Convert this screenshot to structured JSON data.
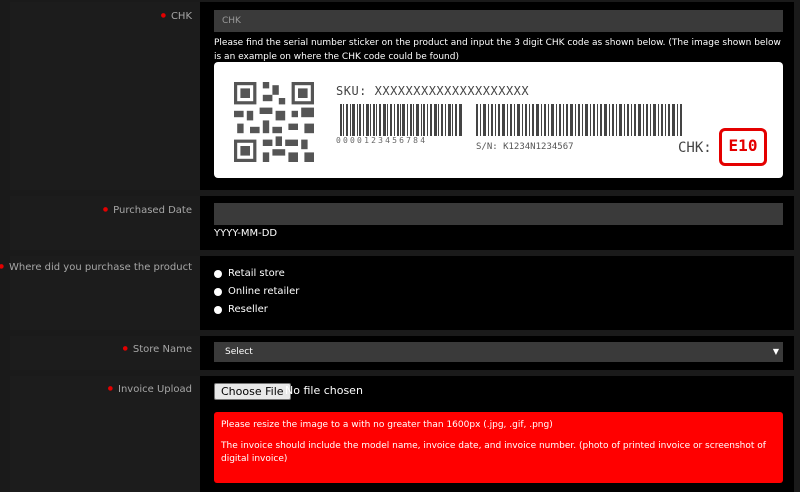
{
  "chk": {
    "label": "CHK",
    "placeholder": "CHK",
    "help": "Please find the serial number sticker on the product and input the 3 digit CHK code as shown below. (The image shown below is an example on where the CHK code could be found)",
    "sticker": {
      "sku": "SKU: XXXXXXXXXXXXXXXXXXXX",
      "barcode_digits": "0000123456784",
      "sn": "S/N: K1234N1234567",
      "chk_label": "CHK:",
      "chk_code": "E10",
      "highlight_color": "#e40000"
    }
  },
  "purchased_date": {
    "label": "Purchased Date",
    "hint": "YYYY-MM-DD"
  },
  "purchase_place": {
    "label": "Where did you purchase the product",
    "options": [
      "Retail store",
      "Online retailer",
      "Reseller"
    ]
  },
  "store_name": {
    "label": "Store Name",
    "selected": "Select"
  },
  "invoice": {
    "label": "Invoice Upload",
    "button": "Choose File",
    "status": "No file chosen",
    "alert_line1": "Please resize the image to a with no greater than 1600px (.jpg, .gif, .png)",
    "alert_line2": "The invoice should include the model name, invoice date, and invoice number. (photo of printed invoice or screenshot of digital invoice)",
    "alert_color": "#ff0000"
  },
  "colors": {
    "required_dot": "#e40000",
    "field_bg": "#3a3a3a",
    "label_col_bg": "#1c1c1c",
    "row_bg": "#000000"
  }
}
